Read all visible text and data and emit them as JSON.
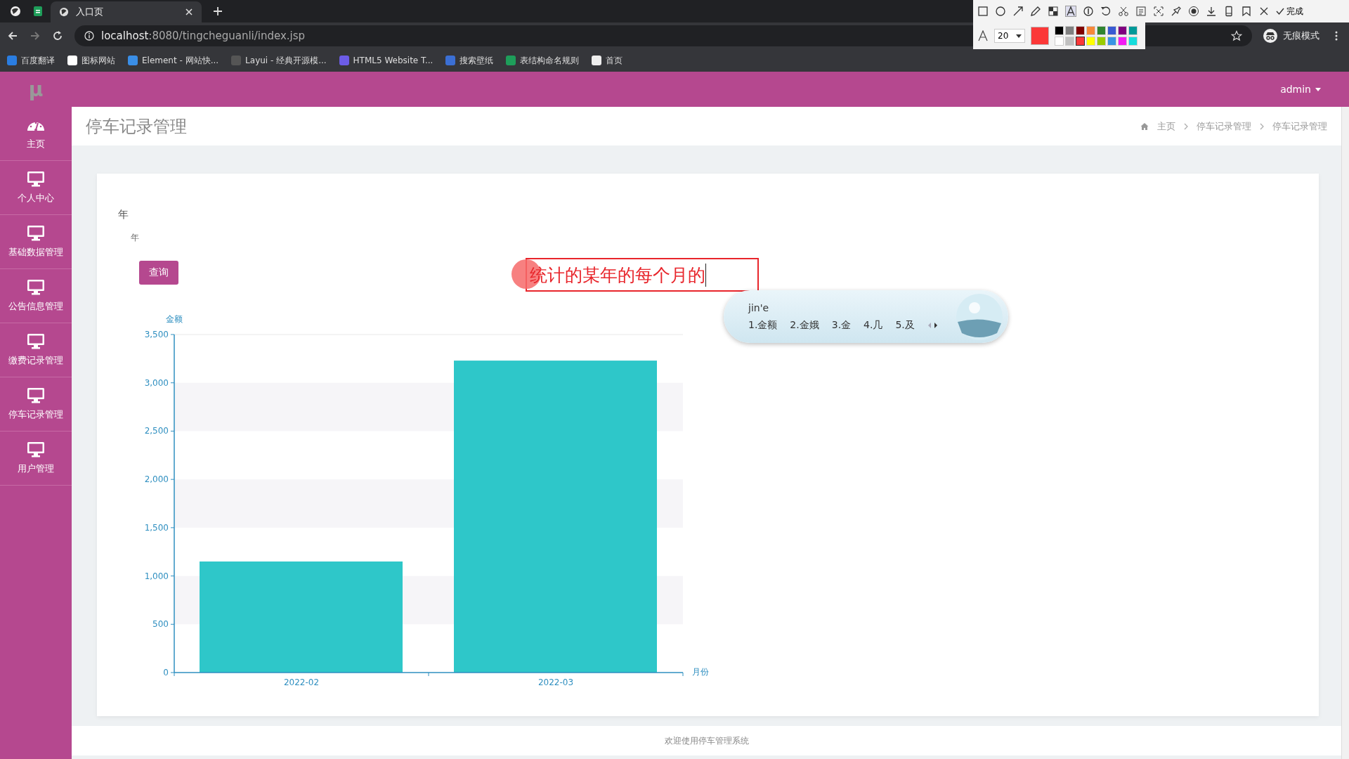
{
  "browser": {
    "tabs": [
      {
        "title": "入口页",
        "selected": true
      }
    ],
    "url_host": "localhost",
    "url_rest": ":8080/tingcheguanli/index.jsp",
    "profile": "无痕模式",
    "bookmarks": [
      "百度翻译",
      "图标网站",
      "Element - 网站快...",
      "Layui - 经典开源模...",
      "HTML5 Website T...",
      "搜索壁纸",
      "表结构命名规则",
      "首页"
    ]
  },
  "capture_tool": {
    "done": "完成",
    "font_size": "20",
    "palette": [
      {
        "color": "#000000",
        "selected": false
      },
      {
        "color": "#808080",
        "selected": false
      },
      {
        "color": "#800000",
        "selected": false
      },
      {
        "color": "#f7883a",
        "selected": false
      },
      {
        "color": "#308430",
        "selected": false
      },
      {
        "color": "#385ad3",
        "selected": false
      },
      {
        "color": "#800080",
        "selected": false
      },
      {
        "color": "#009999",
        "selected": false
      },
      {
        "color": "#ffffff",
        "selected": false
      },
      {
        "color": "#c0c0c0",
        "selected": false
      },
      {
        "color": "#fb3838",
        "selected": true
      },
      {
        "color": "#ffff00",
        "selected": false
      },
      {
        "color": "#99cc00",
        "selected": false
      },
      {
        "color": "#3894e4",
        "selected": false
      },
      {
        "color": "#f31bf3",
        "selected": false
      },
      {
        "color": "#16dcdc",
        "selected": false
      }
    ],
    "annotation": "统计的某年的每个月的"
  },
  "ime": {
    "composition": "jin'e",
    "candidates": [
      "1.金额",
      "2.金娥",
      "3.金",
      "4.几",
      "5.及"
    ]
  },
  "app": {
    "logo": "μ",
    "user": "admin",
    "sidebar": [
      {
        "label": "主页",
        "kind": "dashboard",
        "selected": false
      },
      {
        "label": "个人中心",
        "kind": "monitor",
        "selected": false
      },
      {
        "label": "基础数据管理",
        "kind": "monitor",
        "selected": false
      },
      {
        "label": "公告信息管理",
        "kind": "monitor",
        "selected": false
      },
      {
        "label": "缴费记录管理",
        "kind": "monitor",
        "selected": false
      },
      {
        "label": "停车记录管理",
        "kind": "monitor",
        "selected": false
      },
      {
        "label": "用户管理",
        "kind": "monitor",
        "selected": false
      }
    ],
    "page_title": "停车记录管理",
    "breadcrumb": [
      "主页",
      "停车记录管理",
      "停车记录管理"
    ],
    "form": {
      "label": "年",
      "placeholder": "年",
      "button": "查询"
    },
    "chart_data": {
      "type": "bar",
      "xlabel": "月份",
      "ylabel": "金额",
      "categories": [
        "2022-02",
        "2022-03"
      ],
      "series": [
        {
          "color": "#2ec7c9",
          "values": [
            1150,
            3230
          ]
        }
      ],
      "ylim": [
        0,
        3500
      ],
      "yticks": [
        {
          "value": 0,
          "label": "0"
        },
        {
          "value": 500,
          "label": "500"
        },
        {
          "value": 1000,
          "label": "1,000"
        },
        {
          "value": 1500,
          "label": "1,500"
        },
        {
          "value": 2000,
          "label": "2,000"
        },
        {
          "value": 2500,
          "label": "2,500"
        },
        {
          "value": 3000,
          "label": "3,000"
        },
        {
          "value": 3500,
          "label": "3,500"
        }
      ]
    },
    "footer": "欢迎使用停车管理系统"
  }
}
